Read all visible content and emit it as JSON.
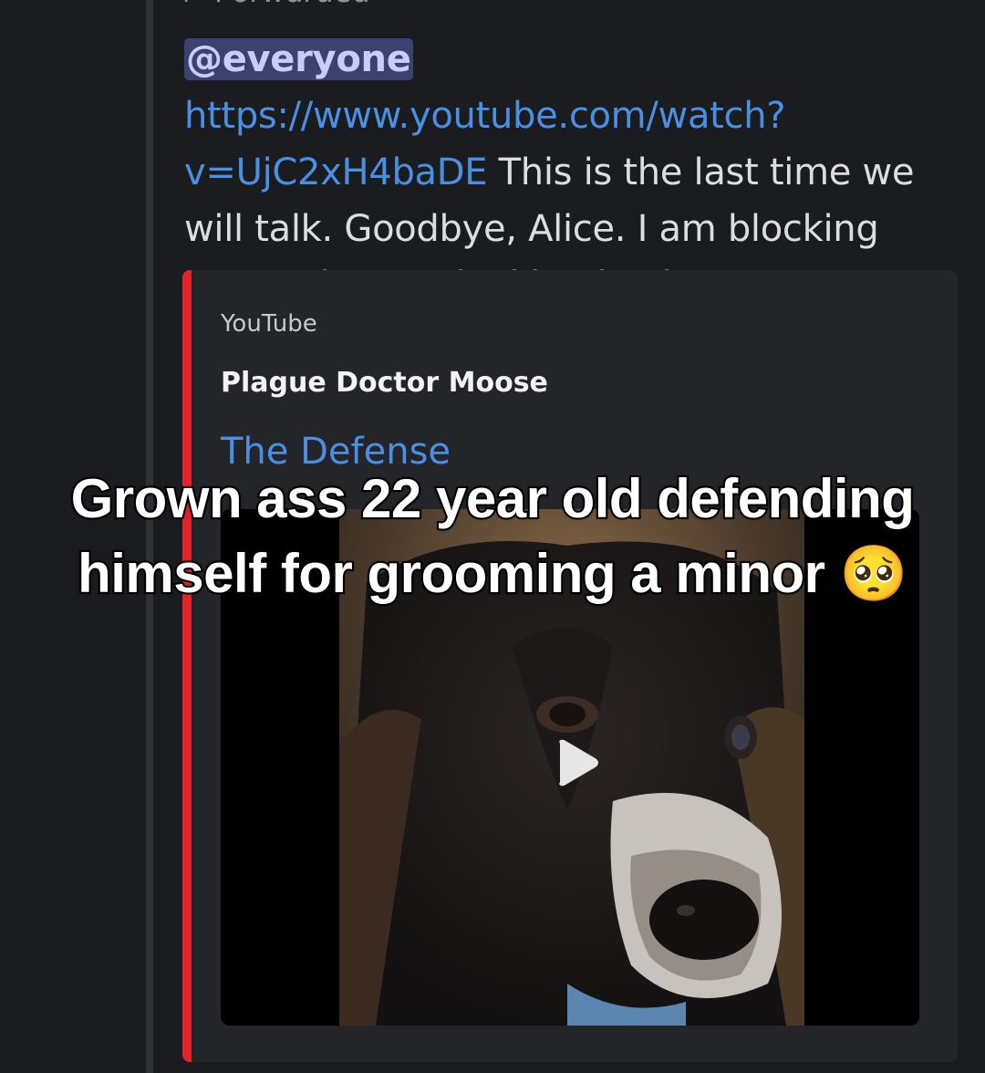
{
  "message": {
    "forwarded_label": "Forwarded",
    "forwarded_icon": "forward-arrow-icon",
    "mention": "@everyone",
    "link_text_line1": "https://www.youtube.com/",
    "link_text_line2": "watch?v=UjC2xH4baDE",
    "body_after_link": " This is the last time we will talk. Goodbye, Alice. I am blocking you and never looking back."
  },
  "embed": {
    "provider": "YouTube",
    "author": "Plague Doctor Moose",
    "title": "The Defense",
    "accent_color": "#e0242a",
    "video_play_icon": "play-icon"
  },
  "overlay_caption": {
    "line1": "Grown ass 22 year old defending",
    "line2": "himself for grooming a minor 🥺"
  },
  "colors": {
    "background": "#1b1c20",
    "embed_background": "#242529",
    "link": "#4a90e2",
    "mention_background": "#3c4270",
    "text": "#dcddde"
  }
}
